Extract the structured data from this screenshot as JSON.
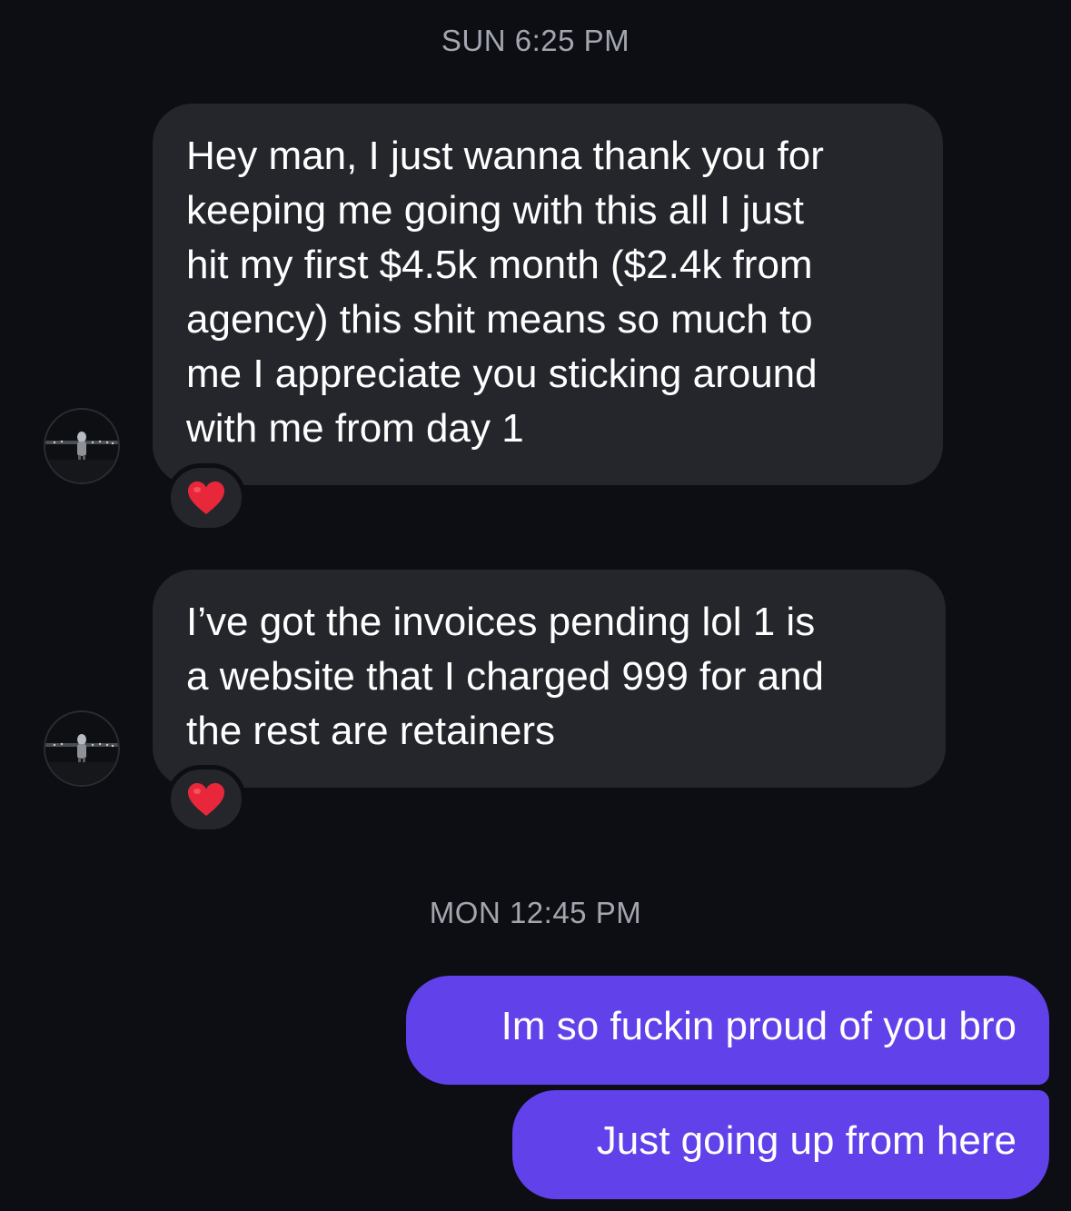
{
  "conversation": {
    "sections": [
      {
        "timestamp": "SUN 6:25 PM",
        "messages": [
          {
            "direction": "incoming",
            "text": "Hey man, I just wanna thank you for\nkeeping me going with this all I just\nhit my first $4.5k month ($2.4k from\nagency) this shit means so much to\nme I appreciate you sticking around\nwith me from day 1",
            "reaction_icon": "red-heart-icon"
          },
          {
            "direction": "incoming",
            "text": "I’ve got the invoices pending lol 1 is\na website that I charged 999 for and\nthe rest are retainers",
            "reaction_icon": "red-heart-icon"
          }
        ]
      },
      {
        "timestamp": "MON 12:45 PM",
        "messages": [
          {
            "direction": "outgoing",
            "text": "Im so fuckin proud of you bro"
          },
          {
            "direction": "outgoing",
            "text": "Just going up from here"
          }
        ]
      }
    ]
  },
  "colors": {
    "background": "#0c0e14",
    "incoming_bubble": "#24262c",
    "outgoing_bubble": "#6141e9",
    "timestamp_text": "#a3a6ae",
    "heart": "#e8283a"
  }
}
